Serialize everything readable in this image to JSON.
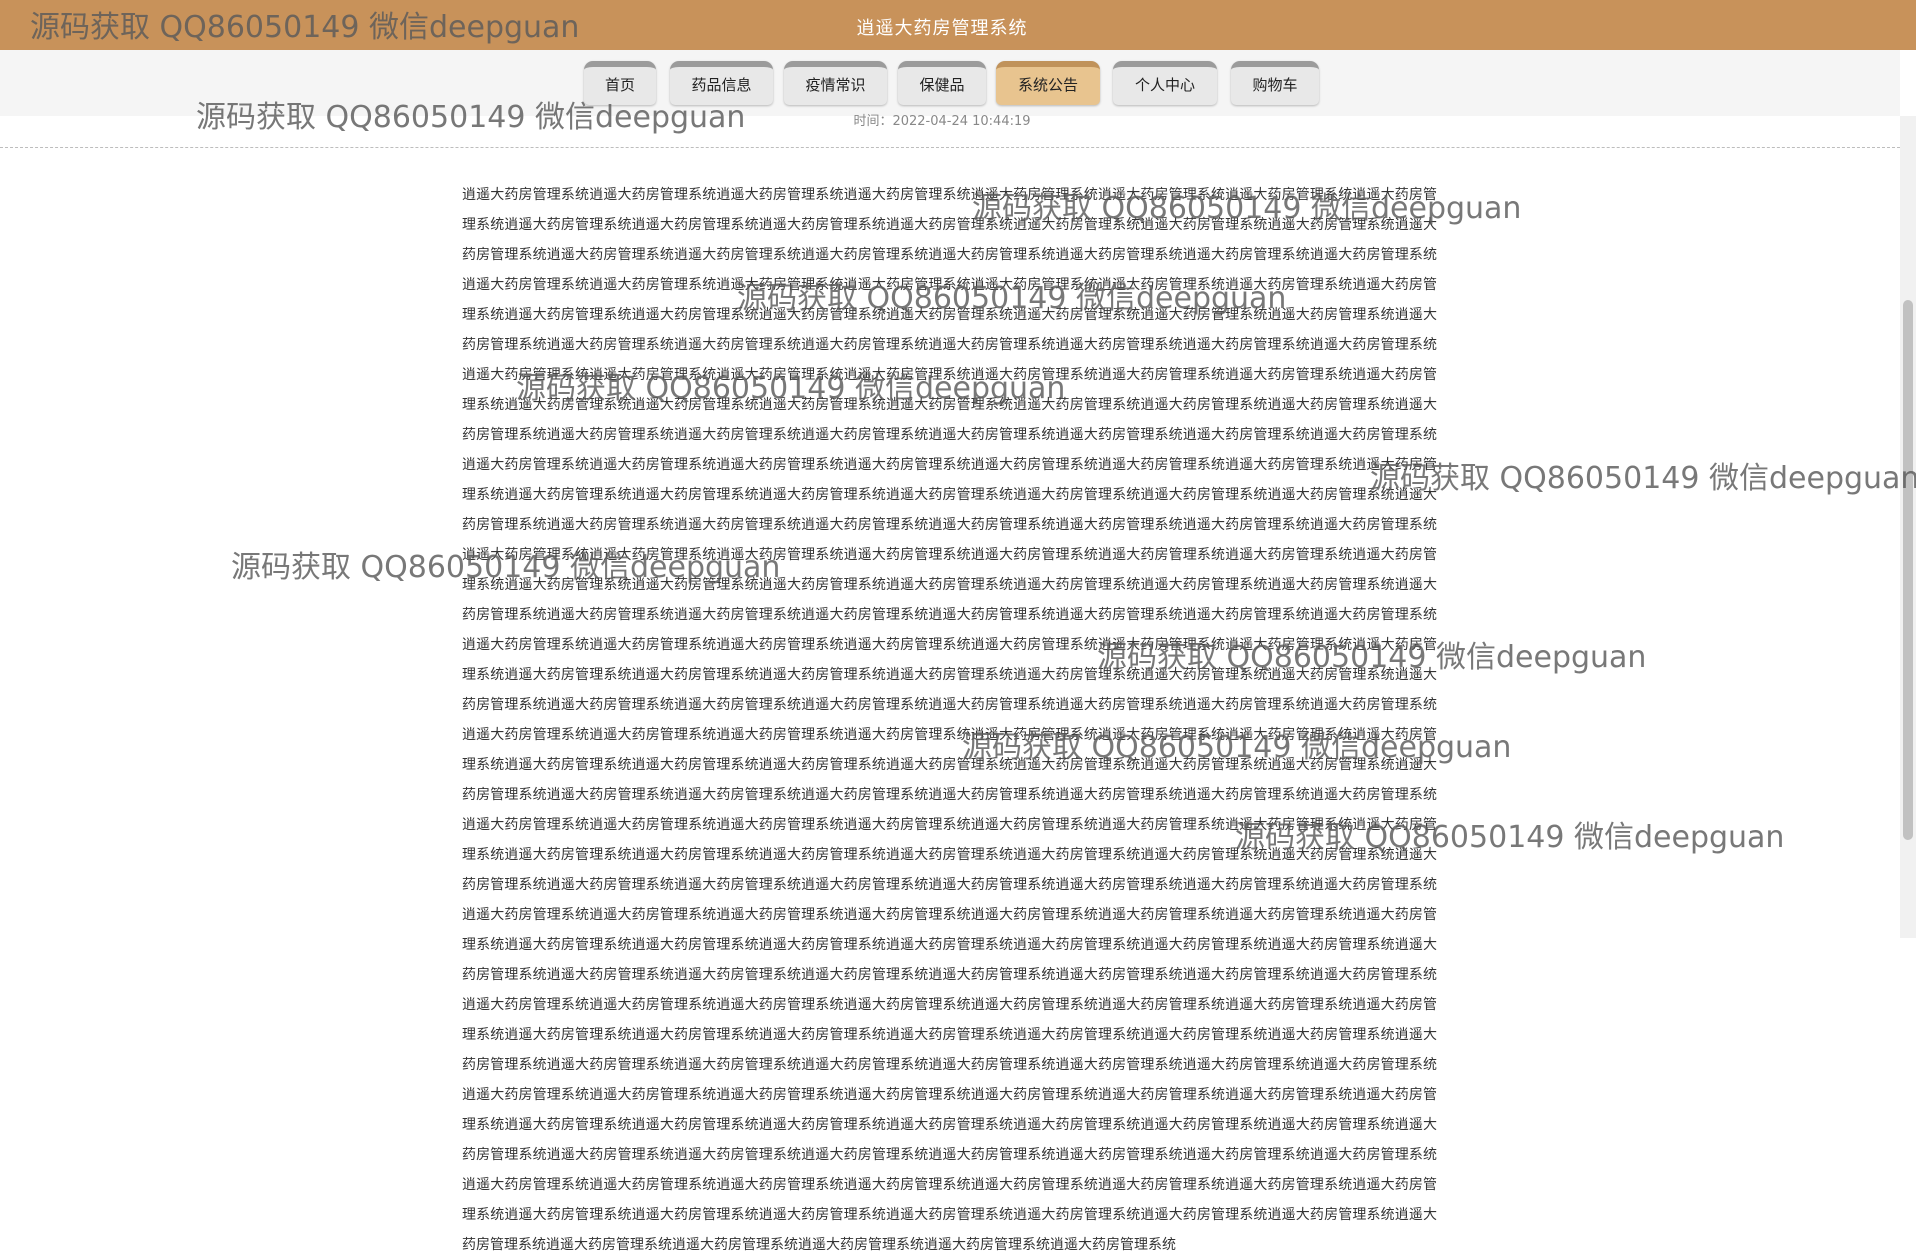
{
  "header": {
    "site_title": "逍遥大药房管理系统"
  },
  "nav": {
    "items": [
      {
        "label": "首页"
      },
      {
        "label": "药品信息"
      },
      {
        "label": "疫情常识"
      },
      {
        "label": "保健品"
      },
      {
        "label": "系统公告",
        "active": true
      },
      {
        "label": "个人中心"
      },
      {
        "label": "购物车"
      }
    ]
  },
  "article": {
    "time_text": "时间：2022-04-24 10:44:19",
    "content": "逍遥大药房管理系统逍遥大药房管理系统逍遥大药房管理系统逍遥大药房管理系统逍遥大药房管理系统逍遥大药房管理系统逍遥大药房管理系统逍遥大药房管理系统逍遥大药房管理系统逍遥大药房管理系统逍遥大药房管理系统逍遥大药房管理系统逍遥大药房管理系统逍遥大药房管理系统逍遥大药房管理系统逍遥大药房管理系统逍遥大药房管理系统逍遥大药房管理系统逍遥大药房管理系统逍遥大药房管理系统逍遥大药房管理系统逍遥大药房管理系统逍遥大药房管理系统逍遥大药房管理系统逍遥大药房管理系统逍遥大药房管理系统逍遥大药房管理系统逍遥大药房管理系统逍遥大药房管理系统逍遥大药房管理系统逍遥大药房管理系统逍遥大药房管理系统逍遥大药房管理系统逍遥大药房管理系统逍遥大药房管理系统逍遥大药房管理系统逍遥大药房管理系统逍遥大药房管理系统逍遥大药房管理系统逍遥大药房管理系统逍遥大药房管理系统逍遥大药房管理系统逍遥大药房管理系统逍遥大药房管理系统逍遥大药房管理系统逍遥大药房管理系统逍遥大药房管理系统逍遥大药房管理系统逍遥大药房管理系统逍遥大药房管理系统逍遥大药房管理系统逍遥大药房管理系统逍遥大药房管理系统逍遥大药房管理系统逍遥大药房管理系统逍遥大药房管理系统逍遥大药房管理系统逍遥大药房管理系统逍遥大药房管理系统逍遥大药房管理系统逍遥大药房管理系统逍遥大药房管理系统逍遥大药房管理系统逍遥大药房管理系统逍遥大药房管理系统逍遥大药房管理系统逍遥大药房管理系统逍遥大药房管理系统逍遥大药房管理系统逍遥大药房管理系统逍遥大药房管理系统逍遥大药房管理系统逍遥大药房管理系统逍遥大药房管理系统逍遥大药房管理系统逍遥大药房管理系统逍遥大药房管理系统逍遥大药房管理系统逍遥大药房管理系统逍遥大药房管理系统逍遥大药房管理系统逍遥大药房管理系统逍遥大药房管理系统逍遥大药房管理系统逍遥大药房管理系统逍遥大药房管理系统逍遥大药房管理系统逍遥大药房管理系统逍遥大药房管理系统逍遥大药房管理系统逍遥大药房管理系统逍遥大药房管理系统逍遥大药房管理系统逍遥大药房管理系统逍遥大药房管理系统逍遥大药房管理系统逍遥大药房管理系统逍遥大药房管理系统逍遥大药房管理系统逍遥大药房管理系统逍遥大药房管理系统逍遥大药房管理系统逍遥大药房管理系统逍遥大药房管理系统逍遥大药房管理系统逍遥大药房管理系统逍遥大药房管理系统逍遥大药房管理系统逍遥大药房管理系统逍遥大药房管理系统逍遥大药房管理系统逍遥大药房管理系统逍遥大药房管理系统逍遥大药房管理系统逍遥大药房管理系统逍遥大药房管理系统逍遥大药房管理系统逍遥大药房管理系统逍遥大药房管理系统逍遥大药房管理系统逍遥大药房管理系统逍遥大药房管理系统逍遥大药房管理系统逍遥大药房管理系统逍遥大药房管理系统逍遥大药房管理系统逍遥大药房管理系统逍遥大药房管理系统逍遥大药房管理系统逍遥大药房管理系统逍遥大药房管理系统逍遥大药房管理系统逍遥大药房管理系统逍遥大药房管理系统逍遥大药房管理系统逍遥大药房管理系统逍遥大药房管理系统逍遥大药房管理系统逍遥大药房管理系统逍遥大药房管理系统逍遥大药房管理系统逍遥大药房管理系统逍遥大药房管理系统逍遥大药房管理系统逍遥大药房管理系统逍遥大药房管理系统逍遥大药房管理系统逍遥大药房管理系统逍遥大药房管理系统逍遥大药房管理系统逍遥大药房管理系统逍遥大药房管理系统逍遥大药房管理系统逍遥大药房管理系统逍遥大药房管理系统逍遥大药房管理系统逍遥大药房管理系统逍遥大药房管理系统逍遥大药房管理系统逍遥大药房管理系统逍遥大药房管理系统逍遥大药房管理系统逍遥大药房管理系统逍遥大药房管理系统逍遥大药房管理系统逍遥大药房管理系统逍遥大药房管理系统逍遥大药房管理系统逍遥大药房管理系统逍遥大药房管理系统逍遥大药房管理系统逍遥大药房管理系统逍遥大药房管理系统逍遥大药房管理系统逍遥大药房管理系统逍遥大药房管理系统逍遥大药房管理系统逍遥大药房管理系统逍遥大药房管理系统逍遥大药房管理系统逍遥大药房管理系统逍遥大药房管理系统逍遥大药房管理系统逍遥大药房管理系统逍遥大药房管理系统逍遥大药房管理系统逍遥大药房管理系统逍遥大药房管理系统逍遥大药房管理系统逍遥大药房管理系统逍遥大药房管理系统逍遥大药房管理系统逍遥大药房管理系统逍遥大药房管理系统逍遥大药房管理系统逍遥大药房管理系统逍遥大药房管理系统逍遥大药房管理系统逍遥大药房管理系统逍遥大药房管理系统逍遥大药房管理系统逍遥大药房管理系统逍遥大药房管理系统逍遥大药房管理系统逍遥大药房管理系统逍遥大药房管理系统逍遥大药房管理系统逍遥大药房管理系统逍遥大药房管理系统逍遥大药房管理系统逍遥大药房管理系统逍遥大药房管理系统逍遥大药房管理系统逍遥大药房管理系统逍遥大药房管理系统逍遥大药房管理系统逍遥大药房管理系统逍遥大药房管理系统逍遥大药房管理系统逍遥大药房管理系统逍遥大药房管理系统逍遥大药房管理系统逍遥大药房管理系统逍遥大药房管理系统逍遥大药房管理系统逍遥大药房管理系统逍遥大药房管理系统逍遥大药房管理系统逍遥大药房管理系统逍遥大药房管理系统逍遥大药房管理系统逍遥大药房管理系统逍遥大药房管理系统逍遥大药房管理系统逍遥大药房管理系统逍遥大药房管理系统逍遥大药房管理系统逍遥大药房管理系统逍遥大药房管理系统逍遥大药房管理系统逍遥大药房管理系统逍遥大药房管理系统逍遥大药房管理系统逍遥大药房管理系统逍遥大药房管理系统逍遥大药房管理系统逍遥大药房管理系统逍遥大药房管理系统逍遥大药房管理系统逍遥大药房管理系统逍遥大药房管理系统逍遥大药房管理系统逍遥大药房管理系统逍遥大药房管理系统逍遥大药房管理系统逍遥大药房管理系统逍遥大药房管理系统逍遥大药房管理系统逍遥大药房管理系统逍遥大药房管理系统逍遥大药房管理系统逍遥大药房管理系统逍遥大药房管理系统逍遥大药房管理系统逍遥大药房管理系统逍遥大药房管理系统逍遥大药房管理系统逍遥大药房管理系统逍遥大药房管理系统逍遥大药房管理系统逍遥大药房管理系统逍遥大药房管理系统逍遥大药房管理系统逍遥大药房管理系统"
  },
  "watermark": {
    "text": "源码获取 QQ86050149 微信deepguan"
  }
}
